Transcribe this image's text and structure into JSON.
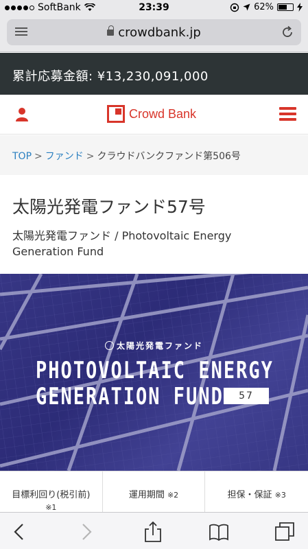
{
  "status_bar": {
    "carrier": "SoftBank",
    "time": "23:39",
    "battery": "62%",
    "battery_level": 0.62
  },
  "browser": {
    "url": "crowdbank.jp"
  },
  "total_bar": {
    "text": "累計応募金額: ¥13,230,091,000"
  },
  "header": {
    "logo_text": "Crowd Bank"
  },
  "breadcrumb": {
    "items": [
      "TOP",
      "ファンド",
      "クラウドバンクファンド第506号"
    ],
    "separator": ">"
  },
  "fund": {
    "title": "太陽光発電ファンド57号",
    "subtitle": "太陽光発電ファンド / Photovoltaic Energy Generation Fund"
  },
  "hero": {
    "tag": "太陽光発電ファンド",
    "line1": "PHOTOVOLTAIC ENERGY",
    "line2": "GENERATION FUND",
    "number": "57"
  },
  "info": {
    "col1_label": "目標利回り(税引前)",
    "col1_note": "※1",
    "col2_label": "運用期間",
    "col2_note": "※2",
    "col3_label": "担保・保証",
    "col3_note": "※3"
  },
  "colors": {
    "brand_red": "#d8352a",
    "link_blue": "#2a7fc0",
    "dark_bar": "#2d3436"
  }
}
